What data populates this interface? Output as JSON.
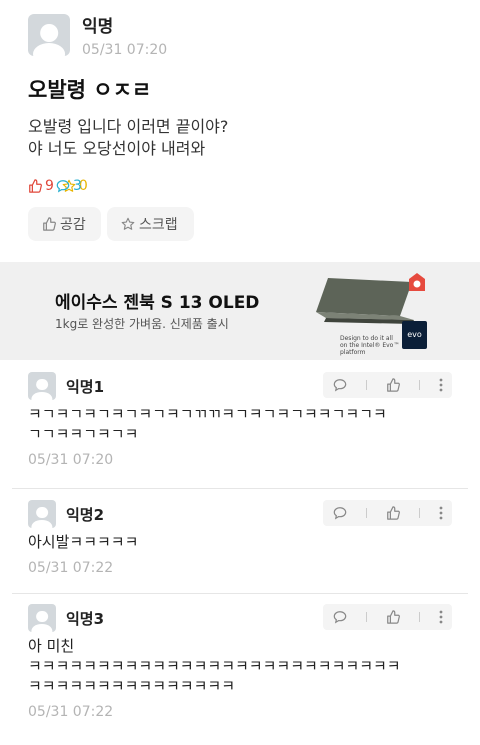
{
  "post": {
    "author": "익명",
    "time": "05/31 07:20",
    "title": "오발령 ㅇㅈㄹ",
    "body_lines": [
      "오발령 입니다 이러면 끝이야?",
      "야 너도 오당선이야 내려와"
    ],
    "likes": "9",
    "comments": "3",
    "scraps": "0",
    "like_button": "공감",
    "scrap_button": "스크랩"
  },
  "ad": {
    "title": "에이수스 젠북 S 13 OLED",
    "subtitle": "1kg로 완성한 가벼움. 신제품 출시",
    "fine_print": "Design to do it all on the Intel® Evo™ platform",
    "badge": "evo"
  },
  "comments": [
    {
      "author": "익명1",
      "lines": [
        "ㅋㄱㅋㄱㅋㄱㅋㄱㅋㄱㅋㄱㄲㄲㅋㄱㅋㄱㅋㄱㅋㅋㄱㅋㄱㅋ",
        "ㄱㄱㅋㅋㄱㅋㄱㅋ"
      ],
      "time": "05/31 07:20"
    },
    {
      "author": "익명2",
      "lines": [
        "아시발ㅋㅋㅋㅋㅋ"
      ],
      "time": "05/31 07:22"
    },
    {
      "author": "익명3",
      "lines": [
        "아 미친",
        "ㅋㅋㅋㅋㅋㅋㅋㅋㅋㅋㅋㅋㅋㅋㅋㅋㅋㅋㅋㅋㅋㅋㅋㅋㅋㅋㅋ",
        "ㅋㅋㅋㅋㅋㅋㅋㅋㅋㅋㅋㅋㅋㅋㅋ"
      ],
      "time": "05/31 07:22"
    }
  ],
  "colors": {
    "like": "#e0473a",
    "comment": "#2bb0d0",
    "scrap": "#e8b400",
    "muted": "#b4b4b4"
  },
  "icons": [
    "avatar-icon",
    "thumbs-up-icon",
    "speech-bubble-icon",
    "star-icon",
    "more-vertical-icon",
    "laptop-image",
    "intel-evo-badge",
    "ad-mark-icon"
  ]
}
